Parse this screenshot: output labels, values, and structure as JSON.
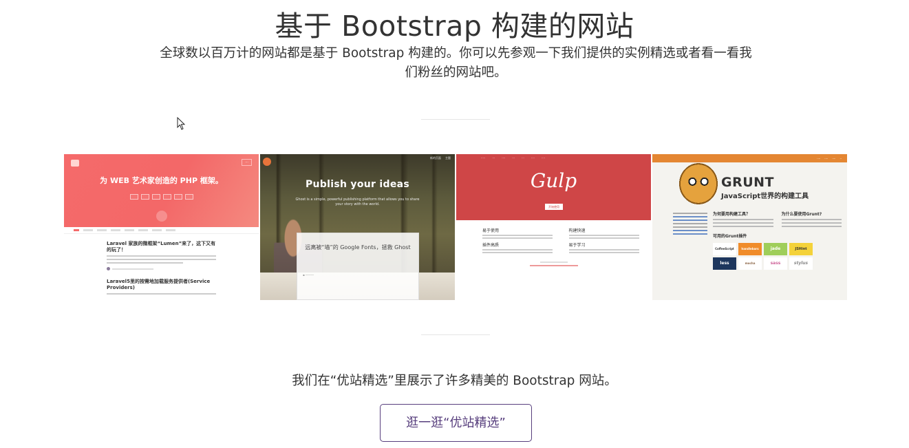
{
  "section": {
    "title": "基于 Bootstrap 构建的网站",
    "lead": "全球数以百万计的网站都是基于 Bootstrap 构建的。你可以先参观一下我们提供的实例精选或者看一看我们粉丝的网站吧。"
  },
  "showcase": {
    "laravel": {
      "title": "为 WEB 艺术家创造的 PHP 框架。",
      "post1_title": "Laravel 家族的微框架“Lumen”来了，这下又有的玩了！",
      "post2_title": "Laravel5里的按需地加载服务提供者(Service Providers)"
    },
    "ghost": {
      "nav1": "新的页面",
      "nav2": "主题",
      "title": "Publish your ideas",
      "subtitle": "Ghost is a simple, powerful publishing platform that allows you to share your story with the world.",
      "box_text": "远离被“墙”的 Google Fonts，拯救 Ghost"
    },
    "gulp": {
      "logo": "Gulp",
      "button": "开始使用",
      "col1": "易于使用",
      "col2": "构建快速",
      "col3": "插件高质",
      "col4": "易于学习"
    },
    "grunt": {
      "name": "GRUNT",
      "subtitle": "JavaScript世界的构建工具",
      "q1": "为何要用构建工具？",
      "q2": "为什么要使用Grunt?",
      "plugins_title": "可用的Grunt插件",
      "plugins": [
        "CoffeeScript",
        "handlebars",
        "jade",
        "JSHint",
        "less",
        "mocha",
        "sass",
        "stylus"
      ]
    }
  },
  "caption": "我们在“优站精选”里展示了许多精美的 Bootstrap 网站。",
  "cta_label": "逛一逛“优站精选”",
  "colors": {
    "brand": "#563d7c",
    "laravel": "#f56a6a",
    "gulp": "#cf4647",
    "grunt": "#e48632"
  }
}
